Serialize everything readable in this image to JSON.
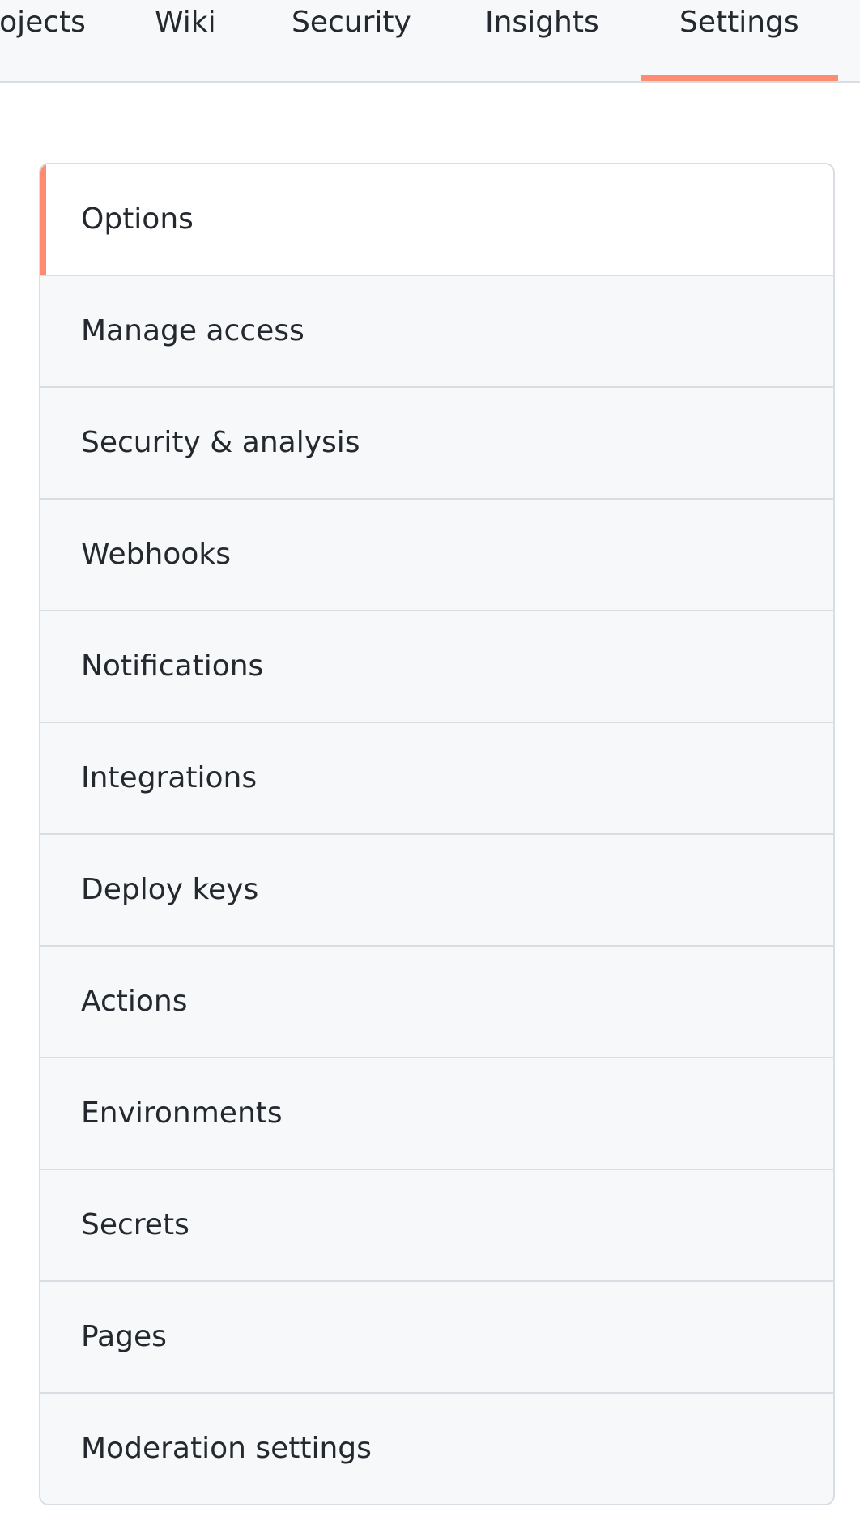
{
  "tabs": [
    {
      "label": "Projects"
    },
    {
      "label": "Wiki"
    },
    {
      "label": "Security"
    },
    {
      "label": "Insights"
    },
    {
      "label": "Settings",
      "selected": true
    }
  ],
  "settings_menu": {
    "items": [
      {
        "label": "Options",
        "selected": true
      },
      {
        "label": "Manage access"
      },
      {
        "label": "Security & analysis"
      },
      {
        "label": "Webhooks"
      },
      {
        "label": "Notifications"
      },
      {
        "label": "Integrations"
      },
      {
        "label": "Deploy keys"
      },
      {
        "label": "Actions"
      },
      {
        "label": "Environments"
      },
      {
        "label": "Secrets"
      },
      {
        "label": "Pages"
      },
      {
        "label": "Moderation settings"
      }
    ]
  },
  "colors": {
    "accent": "#fd8c73",
    "border": "#d8dee4",
    "menu_bg": "#f6f8fa",
    "text": "#24292f"
  }
}
